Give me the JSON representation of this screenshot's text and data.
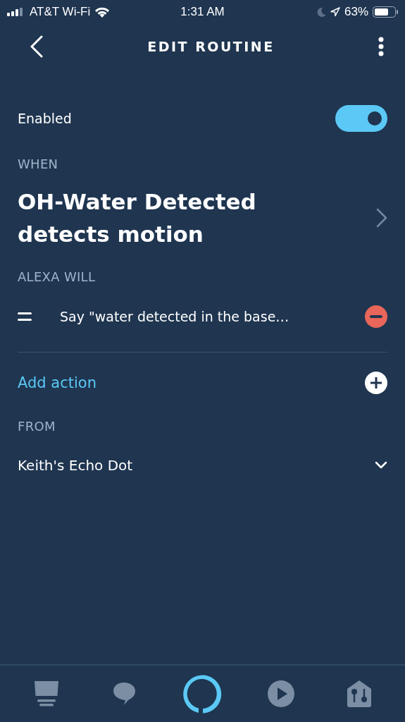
{
  "status_bar": {
    "carrier": "AT&T Wi-Fi",
    "time": "1:31 AM",
    "battery": "63%"
  },
  "header": {
    "title": "EDIT ROUTINE"
  },
  "enabled": {
    "label": "Enabled",
    "on": true
  },
  "when": {
    "label": "WHEN",
    "trigger": "OH-Water Detected detects motion"
  },
  "alexa_will": {
    "label": "ALEXA WILL",
    "actions": [
      {
        "text": "Say \"water detected in the base…"
      }
    ]
  },
  "add_action": {
    "label": "Add action"
  },
  "from": {
    "label": "FROM",
    "device": "Keith's Echo Dot"
  },
  "bottom_nav": [
    {
      "kind": "home",
      "selected": false
    },
    {
      "kind": "chat",
      "selected": false
    },
    {
      "kind": "alexa",
      "selected": true
    },
    {
      "kind": "play",
      "selected": false
    },
    {
      "kind": "devices",
      "selected": false
    }
  ]
}
